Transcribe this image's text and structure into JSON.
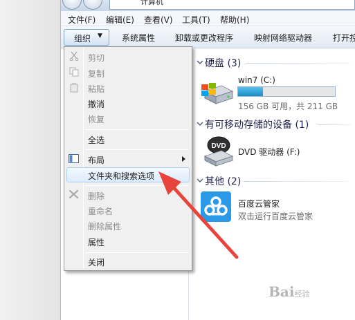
{
  "window": {
    "address_text": "计算机"
  },
  "menubar": {
    "items": [
      "文件(F)",
      "编辑(E)",
      "查看(V)",
      "工具(T)",
      "帮助(H)"
    ]
  },
  "toolbar": {
    "organize_label": "组织",
    "organize_arrow": "▼",
    "commands": [
      "系统属性",
      "卸载或更改程序",
      "映射网络驱动器",
      "打开控"
    ]
  },
  "context_menu": {
    "items": [
      {
        "label": "剪切",
        "enabled": false
      },
      {
        "label": "复制",
        "enabled": false
      },
      {
        "label": "粘贴",
        "enabled": false
      },
      {
        "label": "撤消",
        "enabled": true
      },
      {
        "label": "恢复",
        "enabled": false
      },
      {
        "label": "全选",
        "enabled": true
      },
      {
        "label": "布局",
        "enabled": true,
        "submenu": true
      },
      {
        "label": "文件夹和搜索选项",
        "enabled": true,
        "highlighted": true
      },
      {
        "label": "删除",
        "enabled": false
      },
      {
        "label": "重命名",
        "enabled": false
      },
      {
        "label": "删除属性",
        "enabled": false
      },
      {
        "label": "属性",
        "enabled": true
      },
      {
        "label": "关闭",
        "enabled": true
      }
    ]
  },
  "content": {
    "groups": [
      {
        "title": "硬盘 (3)"
      },
      {
        "title": "有可移动存储的设备 (1)"
      },
      {
        "title": "其他 (2)"
      }
    ],
    "drive_c": {
      "name": "win7 (C:)",
      "space_text": "156 GB 可用，共 211 GB",
      "used_fraction": 0.26
    },
    "dvd": {
      "name": "DVD 驱动器 (F:)",
      "icon_text": "DVD"
    },
    "baidu": {
      "name": "百度云管家",
      "desc": "双击运行百度云管家"
    }
  },
  "colors": {
    "annotation_arrow": "#e8443c",
    "capacity_fill": "#2a9bd3",
    "baidu_tile": "#2b9ae6"
  },
  "watermark": {
    "text": "Bai",
    "sub": "经验"
  }
}
